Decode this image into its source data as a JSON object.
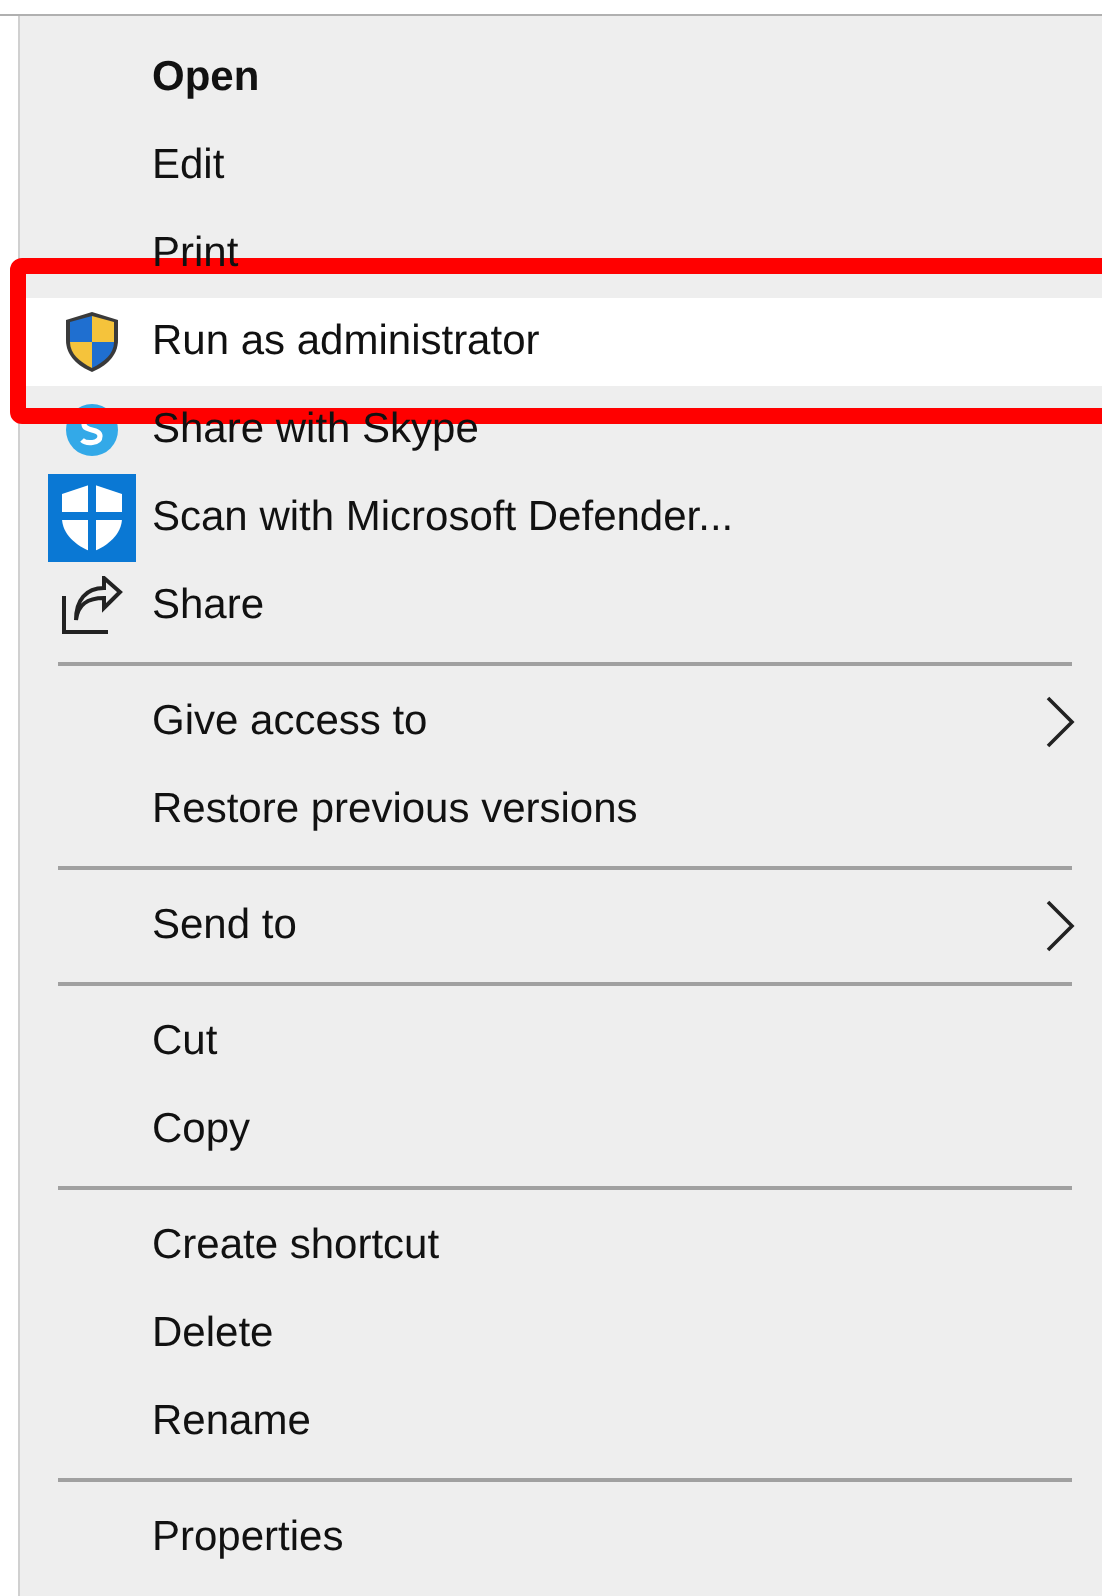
{
  "menu": {
    "items": [
      {
        "kind": "item",
        "label": "Open",
        "default": true,
        "selected": false,
        "submenu": false
      },
      {
        "kind": "item",
        "label": "Edit",
        "default": false,
        "selected": false,
        "submenu": false
      },
      {
        "kind": "item",
        "label": "Print",
        "default": false,
        "selected": false,
        "submenu": false
      },
      {
        "kind": "item",
        "label": "Run as administrator",
        "default": false,
        "selected": true,
        "submenu": false
      },
      {
        "kind": "item",
        "label": "Share with Skype",
        "default": false,
        "selected": false,
        "submenu": false
      },
      {
        "kind": "item",
        "label": "Scan with Microsoft Defender...",
        "default": false,
        "selected": false,
        "submenu": false
      },
      {
        "kind": "item",
        "label": "Share",
        "default": false,
        "selected": false,
        "submenu": false
      },
      {
        "kind": "separator"
      },
      {
        "kind": "item",
        "label": "Give access to",
        "default": false,
        "selected": false,
        "submenu": true
      },
      {
        "kind": "item",
        "label": "Restore previous versions",
        "default": false,
        "selected": false,
        "submenu": false
      },
      {
        "kind": "separator"
      },
      {
        "kind": "item",
        "label": "Send to",
        "default": false,
        "selected": false,
        "submenu": true
      },
      {
        "kind": "separator"
      },
      {
        "kind": "item",
        "label": "Cut",
        "default": false,
        "selected": false,
        "submenu": false
      },
      {
        "kind": "item",
        "label": "Copy",
        "default": false,
        "selected": false,
        "submenu": false
      },
      {
        "kind": "separator"
      },
      {
        "kind": "item",
        "label": "Create shortcut",
        "default": false,
        "selected": false,
        "submenu": false
      },
      {
        "kind": "item",
        "label": "Delete",
        "default": false,
        "selected": false,
        "submenu": false
      },
      {
        "kind": "item",
        "label": "Rename",
        "default": false,
        "selected": false,
        "submenu": false
      },
      {
        "kind": "separator"
      },
      {
        "kind": "item",
        "label": "Properties",
        "default": false,
        "selected": false,
        "submenu": false
      }
    ]
  }
}
